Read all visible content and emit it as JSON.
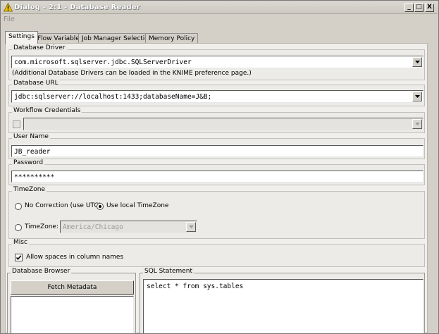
{
  "window": {
    "title": "Dialog - 2:1 - Database Reader",
    "minimize_glyph": "_",
    "maximize_glyph": "□",
    "close_glyph": "X"
  },
  "menu": {
    "file_label": "File"
  },
  "tabs": [
    {
      "label": "Settings",
      "active": true
    },
    {
      "label": "Flow Variables",
      "active": false
    },
    {
      "label": "Job Manager Selection",
      "active": false
    },
    {
      "label": "Memory Policy",
      "active": false
    }
  ],
  "database_driver": {
    "group_label": "Database Driver",
    "value": "com.microsoft.sqlserver.jdbc.SQLServerDriver",
    "note": "(Additional Database Drivers can be loaded in the KNIME preference page.)"
  },
  "database_url": {
    "group_label": "Database URL",
    "value": "jdbc:sqlserver://localhost:1433;databaseName=J&B;"
  },
  "workflow_credentials": {
    "group_label": "Workflow Credentials",
    "checked": false,
    "value": ""
  },
  "user_name": {
    "group_label": "User Name",
    "value": "JB_reader"
  },
  "password": {
    "group_label": "Password",
    "value": "**********"
  },
  "timezone": {
    "group_label": "TimeZone",
    "option_no_correction": "No Correction (use UTC)",
    "option_local": "Use local TimeZone",
    "option_timezone": "TimeZone:",
    "selected": "local",
    "timezone_value": "America/Chicago"
  },
  "misc": {
    "group_label": "Misc",
    "allow_spaces_label": "Allow spaces in column names",
    "allow_spaces_checked": true
  },
  "database_browser": {
    "group_label": "Database Browser",
    "fetch_button": "Fetch Metadata"
  },
  "sql_statement": {
    "group_label": "SQL Statement",
    "value": "select * from sys.tables"
  },
  "colors": {
    "window_bg": "#d4d0c8",
    "panel_bg": "#f0efec",
    "title_text": "#ffffff",
    "warning_icon": "#f2c200"
  },
  "icons": {
    "title": "warning-icon",
    "combo": "chevron-down-icon",
    "check": "checkmark-icon"
  }
}
